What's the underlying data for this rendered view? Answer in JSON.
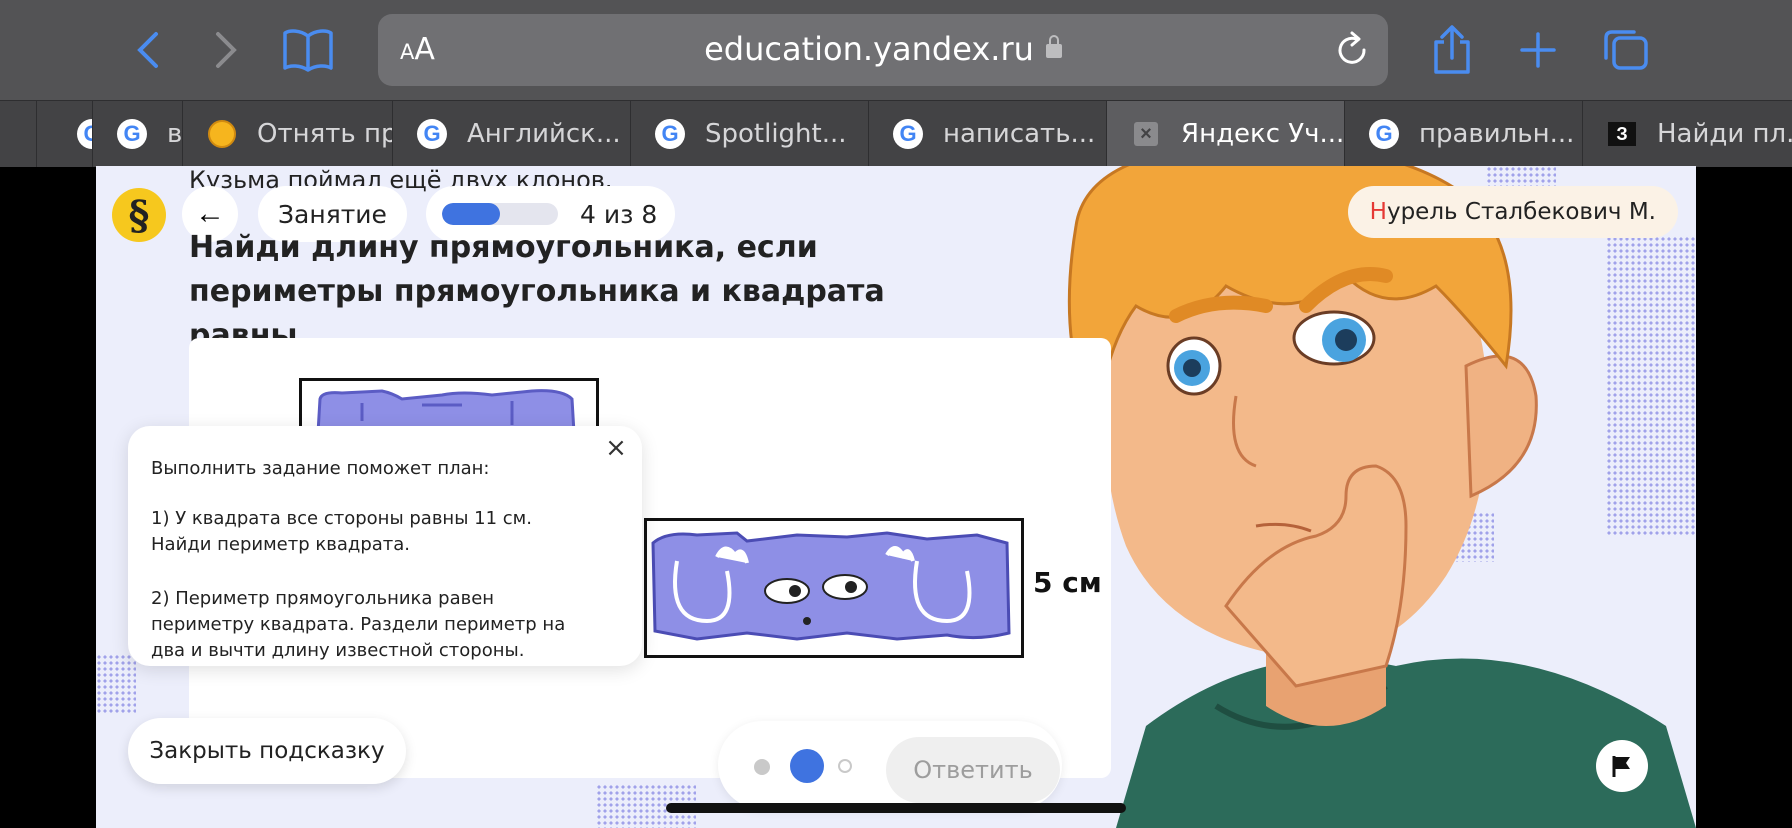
{
  "browser": {
    "font_size_label_small": "A",
    "font_size_label_large": "A",
    "url": "education.yandex.ru",
    "tabs": [
      {
        "label": "",
        "icon": "google-icon"
      },
      {
        "label": "в",
        "icon": "google-icon"
      },
      {
        "label": "Отнять пр...",
        "icon": "orange-circle-icon"
      },
      {
        "label": "Английск...",
        "icon": "google-icon"
      },
      {
        "label": "Spotlight...",
        "icon": "google-icon"
      },
      {
        "label": "написать...",
        "icon": "google-icon"
      },
      {
        "label": "Яндекс Уч...",
        "icon": "close-icon",
        "active": true
      },
      {
        "label": "правильн...",
        "icon": "google-icon"
      },
      {
        "label": "Найди пл...",
        "icon": "z-icon"
      }
    ],
    "z_glyph": "З",
    "google_glyph": "G"
  },
  "lesson": {
    "logo_glyph": "§",
    "back_glyph": "←",
    "lesson_label": "Занятие",
    "progress_text": "4 из 8",
    "progress_fraction": 0.5,
    "user_initial": "Н",
    "user_rest": "урель Сталбекович М.",
    "previous_text": "Кузьма поймал ещё двух клонов.",
    "question": "Найди длину прямоугольника, если периметры прямоугольника и квадрата равны.",
    "rect_dimension": "5 см"
  },
  "hint": {
    "title": "Выполнить задание поможет план:",
    "step1_line1": "1) У квадрата все стороны равны 11 см.",
    "step1_line2": "Найди периметр квадрата.",
    "step2": "2) Периметр прямоугольника равен периметру квадрата. Раздели периметр на два и вычти длину известной стороны.",
    "close_glyph": "×",
    "close_button": "Закрыть подсказку"
  },
  "answer": {
    "button_label": "Ответить",
    "steps_total": 3,
    "step_current": 2
  },
  "colors": {
    "accent": "#3f73e0",
    "monster": "#8e8fe6",
    "page_bg": "#eceefb"
  }
}
